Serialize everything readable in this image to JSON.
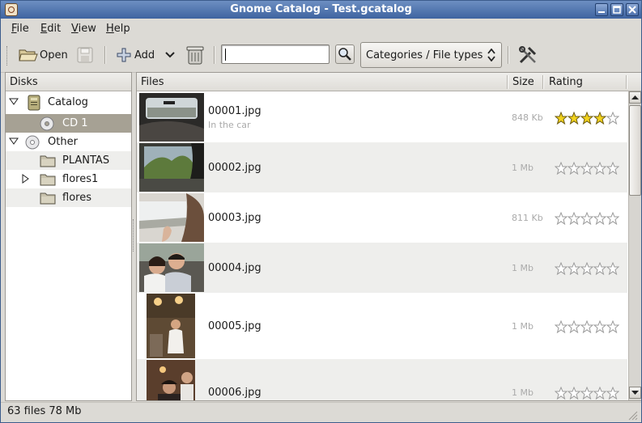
{
  "window": {
    "title": "Gnome Catalog - Test.gcatalog"
  },
  "menu": [
    {
      "label_u": "F",
      "label_rest": "ile"
    },
    {
      "label_u": "E",
      "label_rest": "dit"
    },
    {
      "label_u": "V",
      "label_rest": "iew"
    },
    {
      "label_u": "H",
      "label_rest": "elp"
    }
  ],
  "toolbar": {
    "open_label": "Open",
    "add_label": "Add",
    "search_value": "",
    "filter_combo_value": "Categories / File types"
  },
  "disks": {
    "header": "Disks",
    "items": [
      {
        "label": "Catalog",
        "icon": "catalog-icon",
        "expander": "expanded"
      },
      {
        "label": "CD 1",
        "icon": "cd-icon",
        "selected": true
      },
      {
        "label": "Other",
        "icon": "cd-icon",
        "expander": "expanded"
      },
      {
        "label": "PLANTAS",
        "icon": "folder-icon"
      },
      {
        "label": "flores1",
        "icon": "folder-icon",
        "expander": "collapsed"
      },
      {
        "label": "flores",
        "icon": "folder-icon"
      }
    ]
  },
  "files": {
    "columns": {
      "files": "Files",
      "size": "Size",
      "rating": "Rating"
    },
    "rows": [
      {
        "name": "00001.jpg",
        "description": "In the car",
        "size": "848 Kb",
        "rating": 4
      },
      {
        "name": "00002.jpg",
        "description": "",
        "size": "1 Mb",
        "rating": 0
      },
      {
        "name": "00003.jpg",
        "description": "",
        "size": "811 Kb",
        "rating": 0
      },
      {
        "name": "00004.jpg",
        "description": "",
        "size": "1 Mb",
        "rating": 0
      },
      {
        "name": "00005.jpg",
        "description": "",
        "size": "1 Mb",
        "rating": 0
      },
      {
        "name": "00006.jpg",
        "description": "",
        "size": "1 Mb",
        "rating": 0
      }
    ]
  },
  "status": {
    "text": "63 files 78 Mb"
  },
  "colors": {
    "titlebar": "#3e63a0",
    "selection": "#a6a194",
    "star_filled": "#f2d21d",
    "star_empty": "#ffffff"
  }
}
